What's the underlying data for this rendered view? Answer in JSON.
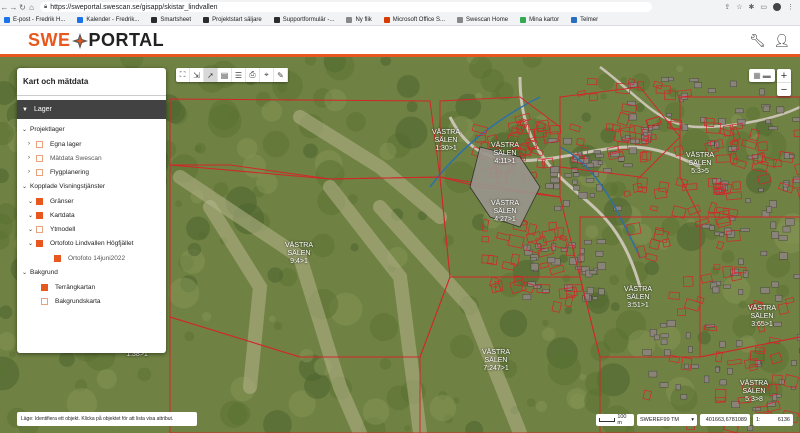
{
  "browser": {
    "url": "https://sweportal.swescan.se/gisapp/skistar_lindvallen",
    "bookmarks": [
      {
        "label": "E-post - Fredrik H...",
        "color": "#1a73e8"
      },
      {
        "label": "Kalender - Fredrik...",
        "color": "#1a73e8"
      },
      {
        "label": "Smartsheet",
        "color": "#2c2c2c"
      },
      {
        "label": "Projektstart säljare",
        "color": "#2c2c2c"
      },
      {
        "label": "Supportformulär -...",
        "color": "#2c2c2c"
      },
      {
        "label": "Ny flik",
        "color": "#888888"
      },
      {
        "label": "Microsoft Office S...",
        "color": "#d83b01"
      },
      {
        "label": "Swescan Home",
        "color": "#888888"
      },
      {
        "label": "Mina kartor",
        "color": "#34a853"
      },
      {
        "label": "Telmer",
        "color": "#2a6fbf"
      }
    ]
  },
  "header": {
    "logo_left": "SWE",
    "logo_right": "PORTAL",
    "accent": "#e8571e"
  },
  "toolbar": {
    "icons": [
      "fullscreen-icon",
      "measure-icon",
      "select-icon",
      "table-icon",
      "layers-stack-icon",
      "print-icon",
      "location-icon",
      "draw-icon"
    ]
  },
  "zoom": {
    "in": "+",
    "out": "−"
  },
  "panel": {
    "title": "Kart och mätdata",
    "section": "Lager",
    "groups": {
      "projektlager": "Projektlager",
      "egna_lager": "Egna lager",
      "matdata": "Mätdata Swescan",
      "flygplanering": "Flygplanering",
      "kopplade": "Kopplade Visningstjänster",
      "granser": "Gränser",
      "kartdata": "Kartdata",
      "ytmodell": "Ytmodell",
      "ortofoto": "Ortofoto Lindvallen Högfjället",
      "ortofoto_sub": "Ortofoto 14juni2022",
      "bakgrund": "Bakgrund",
      "terrang": "Terrängkartan",
      "bakgrundskarta": "Bakgrundskarta"
    }
  },
  "map_labels": [
    {
      "text": "VÄSTRA\nSÄLEN\n1:30>1"
    },
    {
      "text": "VÄSTRA\nSÄLEN\n4:11>1"
    },
    {
      "text": "VÄSTRA\nSÄLEN\n4:27>1"
    },
    {
      "text": "VÄSTRA\nSÄLEN\n9:4>1"
    },
    {
      "text": "VÄSTRA\nSÄLEN\n5:3>5"
    },
    {
      "text": "VÄSTRA\nSÄLEN\n3:51>1"
    },
    {
      "text": "VÄSTRA\nSÄLEN\n3:65>1"
    },
    {
      "text": "VÄSTRA\nSÄLEN\n1:38>1"
    },
    {
      "text": "VÄSTRA\nSÄLEN\n7:247>1"
    },
    {
      "text": "VÄSTRA\nSÄLEN\n5:3>8"
    }
  ],
  "status": {
    "hint": "Läge: Identifiera ett objekt. Klicka på objektet för att lista visa attribut.",
    "scale_label": "100 m",
    "projection": "SWEREF99 TM",
    "coords": "401663,6781089",
    "scale_prefix": "1:",
    "scale_value": "6136"
  }
}
